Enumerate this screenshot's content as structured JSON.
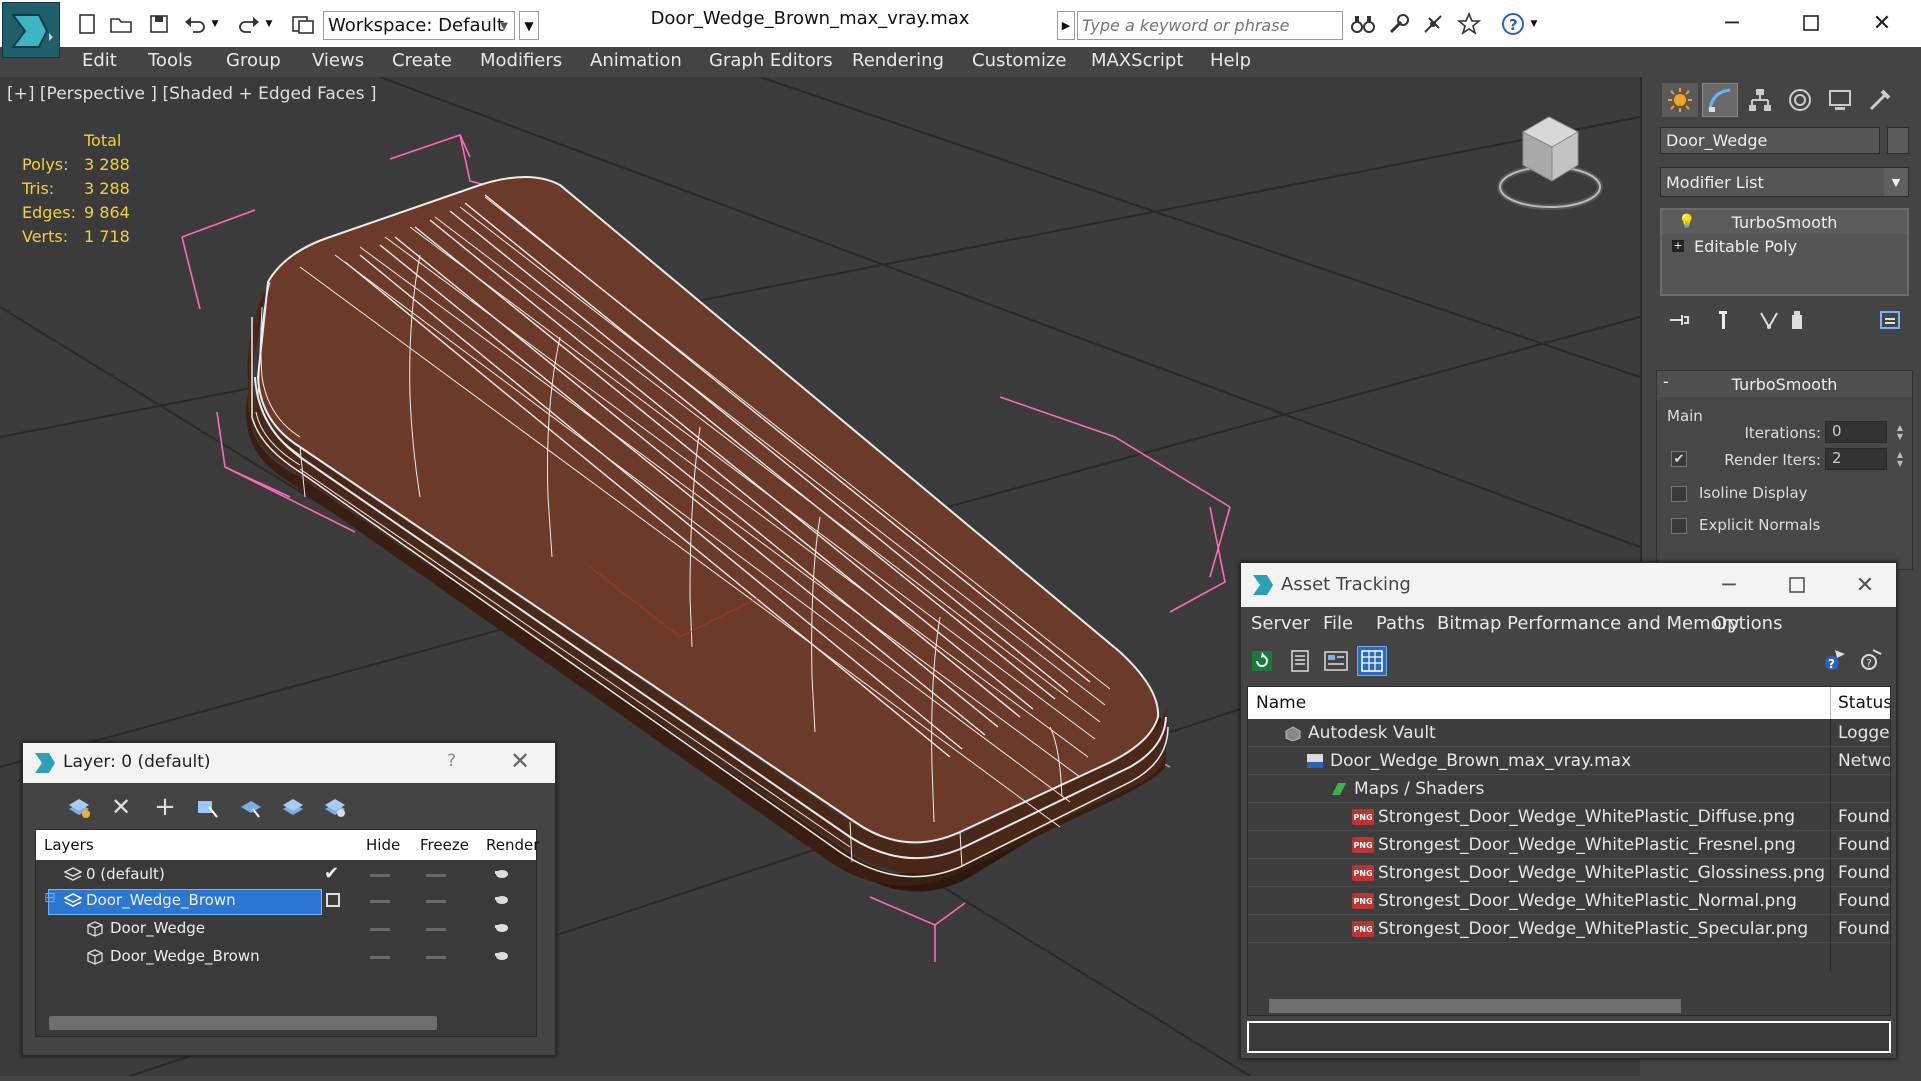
{
  "titlebar": {
    "workspace_label": "Workspace: Default",
    "document_title": "Door_Wedge_Brown_max_vray.max",
    "search_placeholder": "Type a keyword or phrase"
  },
  "menu": [
    "Edit",
    "Tools",
    "Group",
    "Views",
    "Create",
    "Modifiers",
    "Animation",
    "Graph Editors",
    "Rendering",
    "Customize",
    "MAXScript",
    "Help"
  ],
  "viewport": {
    "label": "[+] [Perspective ] [Shaded + Edged Faces ]",
    "stats": {
      "header": "Total",
      "rows": [
        {
          "label": "Polys:",
          "value": "3 288"
        },
        {
          "label": "Tris:",
          "value": "3 288"
        },
        {
          "label": "Edges:",
          "value": "9 864"
        },
        {
          "label": "Verts:",
          "value": "1 718"
        }
      ]
    },
    "colors": {
      "background": "#3b3b3b",
      "object": "#6b3a28",
      "wire": "#ffffff",
      "bbox": "#ff69b4",
      "stats": "#f0d23a"
    }
  },
  "command_panel": {
    "object_name": "Door_Wedge",
    "modifier_list_label": "Modifier List",
    "stack": [
      "TurboSmooth",
      "Editable Poly"
    ],
    "rollout": {
      "title": "TurboSmooth",
      "group": "Main",
      "iterations_label": "Iterations:",
      "iterations_value": "0",
      "render_iters_label": "Render Iters:",
      "render_iters_value": "2",
      "isoline_label": "Isoline Display",
      "explicit_normals_label": "Explicit Normals"
    }
  },
  "layer_dialog": {
    "title": "Layer: 0 (default)",
    "help": "?",
    "columns": {
      "layers": "Layers",
      "hide": "Hide",
      "freeze": "Freeze",
      "render": "Render"
    },
    "rows": [
      {
        "name": "0 (default)"
      },
      {
        "name": "Door_Wedge_Brown"
      },
      {
        "name": "Door_Wedge"
      },
      {
        "name": "Door_Wedge_Brown"
      }
    ]
  },
  "asset_dialog": {
    "title": "Asset Tracking",
    "menu": [
      "Server",
      "File",
      "Paths",
      "Bitmap Performance and Memory",
      "Options"
    ],
    "columns": {
      "name": "Name",
      "status": "Status"
    },
    "rows": [
      {
        "name": "Autodesk Vault",
        "status": "Logged"
      },
      {
        "name": "Door_Wedge_Brown_max_vray.max",
        "status": "Networ"
      },
      {
        "name": "Maps / Shaders",
        "status": ""
      },
      {
        "name": "Strongest_Door_Wedge_WhitePlastic_Diffuse.png",
        "status": "Found"
      },
      {
        "name": "Strongest_Door_Wedge_WhitePlastic_Fresnel.png",
        "status": "Found"
      },
      {
        "name": "Strongest_Door_Wedge_WhitePlastic_Glossiness.png",
        "status": "Found"
      },
      {
        "name": "Strongest_Door_Wedge_WhitePlastic_Normal.png",
        "status": "Found"
      },
      {
        "name": "Strongest_Door_Wedge_WhitePlastic_Specular.png",
        "status": "Found"
      }
    ],
    "png_badge": "PNG"
  }
}
